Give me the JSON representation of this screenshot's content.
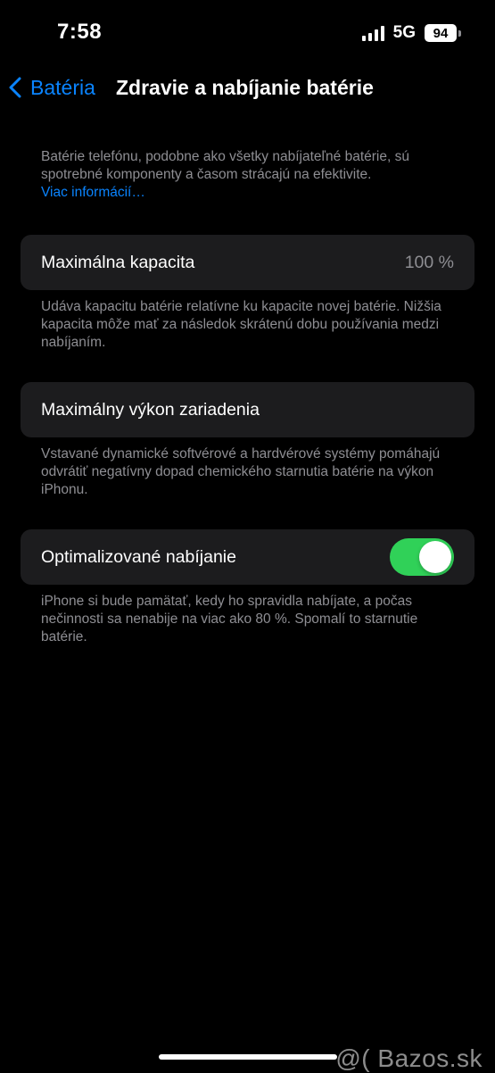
{
  "status_bar": {
    "time": "7:58",
    "network": "5G",
    "battery_level": "94",
    "icons": [
      "signal-bars-icon",
      "battery-icon"
    ]
  },
  "nav": {
    "back_label": "Batéria",
    "back_icon": "chevron-left-icon",
    "title": "Zdravie a nabíjanie batérie"
  },
  "intro": {
    "text": "Batérie telefónu, podobne ako všetky nabíjateľné batérie, sú spotrebné komponenty a časom strácajú na efektivite.",
    "link": "Viac informácií…"
  },
  "max_capacity": {
    "label": "Maximálna kapacita",
    "value": "100 %",
    "footer": "Udáva kapacitu batérie relatívne ku kapacite novej batérie. Nižšia kapacita môže mať za následok skrátenú dobu používania medzi nabíjaním."
  },
  "peak_performance": {
    "label": "Maximálny výkon zariadenia",
    "footer": "Vstavané dynamické softvérové a hardvérové systémy pomáhajú odvrátiť negatívny dopad chemického starnutia batérie na výkon iPhonu."
  },
  "optimized_charging": {
    "label": "Optimalizované nabíjanie",
    "enabled": true,
    "footer": "iPhone si bude pamätať, kedy ho spravidla nabíjate, a počas nečinnosti sa nenabije na viac ako 80 %. Spomalí to starnutie batérie."
  },
  "watermark": "@( Bazos.sk",
  "colors": {
    "background": "#000000",
    "cell_background": "#1c1c1e",
    "accent_blue": "#0a84ff",
    "secondary_text": "#8e8e93",
    "toggle_on": "#30d158"
  }
}
